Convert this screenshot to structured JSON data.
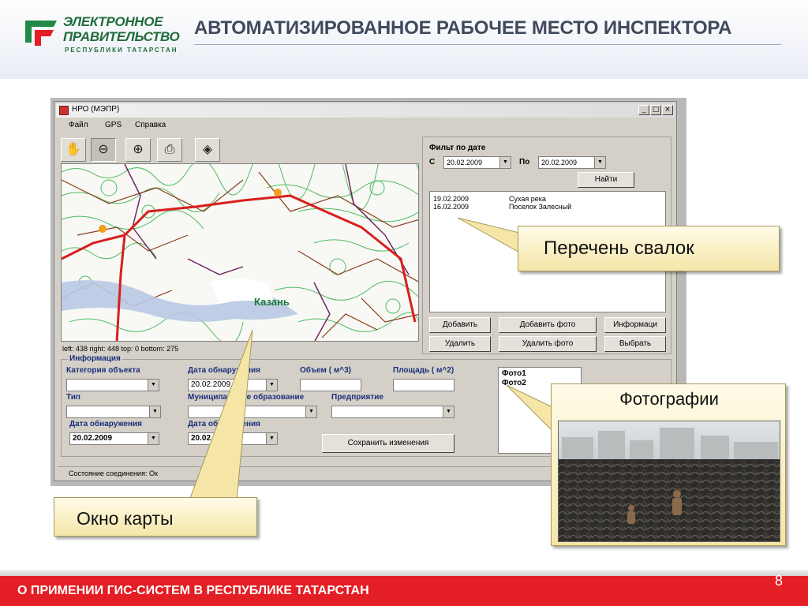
{
  "header": {
    "logo_line1": "ЭЛЕКТРОННОЕ",
    "logo_line2": "ПРАВИТЕЛЬСТВО",
    "logo_line3": "РЕСПУБЛИКИ ТАТАРСТАН",
    "title": "АВТОМАТИЗИРОВАННОЕ РАБОЧЕЕ МЕСТО ИНСПЕКТОРА"
  },
  "window": {
    "title": "НРО (МЭПР)",
    "controls": [
      "_",
      "□",
      "×"
    ],
    "menu": [
      "Файл",
      "GPS",
      "Справка"
    ],
    "toolbar": [
      {
        "name": "hand-icon",
        "glyph": "✋"
      },
      {
        "name": "zoom-out-icon",
        "glyph": "⊖"
      },
      {
        "name": "zoom-in-icon",
        "glyph": "⊕"
      },
      {
        "name": "print-icon",
        "glyph": "⎙"
      },
      {
        "name": "layers-icon",
        "glyph": "◈"
      }
    ],
    "map": {
      "city_label": "Казань",
      "status": "left: 438 right: 448 top: 0 bottom: 275"
    },
    "filter": {
      "group_label": "Фильт по дате",
      "from_label": "С",
      "from_value": "20.02.2009",
      "to_label": "По",
      "to_value": "20.02.2009",
      "find_button": "Найти"
    },
    "dumps_list": [
      {
        "date": "19.02.2009",
        "name": "Сухая река"
      },
      {
        "date": "16.02.2009",
        "name": "Поселок Залесный"
      }
    ],
    "list_buttons": {
      "add": "Добавить",
      "add_photo": "Добавить фото",
      "info": "Информаци",
      "delete": "Удалить",
      "delete_photo": "Удалить фото",
      "select": "Выбрать"
    },
    "info": {
      "group_label": "Информация",
      "category_label": "Категория объекта",
      "category_value": "",
      "discovery_label_1": "Дата обнаружения",
      "discovery_value_1": "20.02.2009",
      "volume_label": "Объем ( м^3)",
      "volume_value": "",
      "area_label": "Площадь ( м^2)",
      "area_value": "",
      "type_label": "Тип",
      "type_value": "",
      "municipality_label": "Муниципальное образование",
      "municipality_value": "",
      "enterprise_label": "Предприятие",
      "enterprise_value": "",
      "discovery_label_2": "Дата обнаружения",
      "discovery_value_2": "20.02.2009",
      "discovery_label_3": "Дата обнаружения",
      "discovery_value_3": "20.02.2009",
      "save_button": "Сохранить изменения",
      "photos": [
        "Фото1",
        "Фото2"
      ]
    },
    "statusbar": "Состояние соединения:   Ок"
  },
  "callouts": {
    "dumps_list": "Перечень свалок",
    "map_window": "Окно карты",
    "photos": "Фотографии"
  },
  "footer": {
    "text": "О ПРИМЕНИИ ГИС-СИСТЕМ В РЕСПУБЛИКЕ ТАТАРСТАН",
    "page": "8"
  },
  "colors": {
    "accent_red": "#e31e24",
    "logo_green": "#1f6b3a",
    "title_gray": "#404a5c",
    "window_gray": "#d4d0c8",
    "label_blue": "#1a2f7a",
    "callout_fill": "#f5e6a8"
  }
}
